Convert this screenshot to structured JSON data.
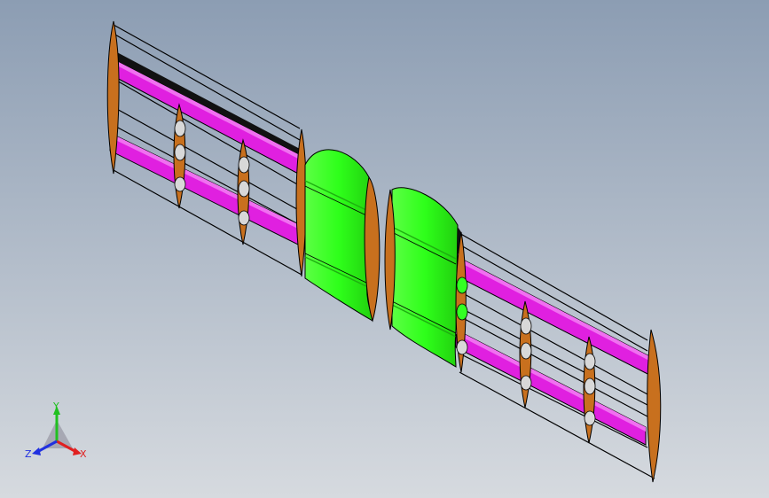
{
  "viewport": {
    "background_top": "#8C9DB3",
    "background_bottom": "#D6DADF"
  },
  "colors": {
    "rib": "#C8701E",
    "rib_dark": "#8A4A10",
    "spar": "#E020E0",
    "spar_dark": "#A010A0",
    "skin": "#33FF22",
    "skin_dark": "#1FB011",
    "edge": "#000000",
    "hole": "#D8D8D8",
    "axis_x": "#E02020",
    "axis_y": "#20C020",
    "axis_z": "#2030E0"
  },
  "triad": {
    "x_label": "X",
    "y_label": "Y",
    "z_label": "Z"
  }
}
